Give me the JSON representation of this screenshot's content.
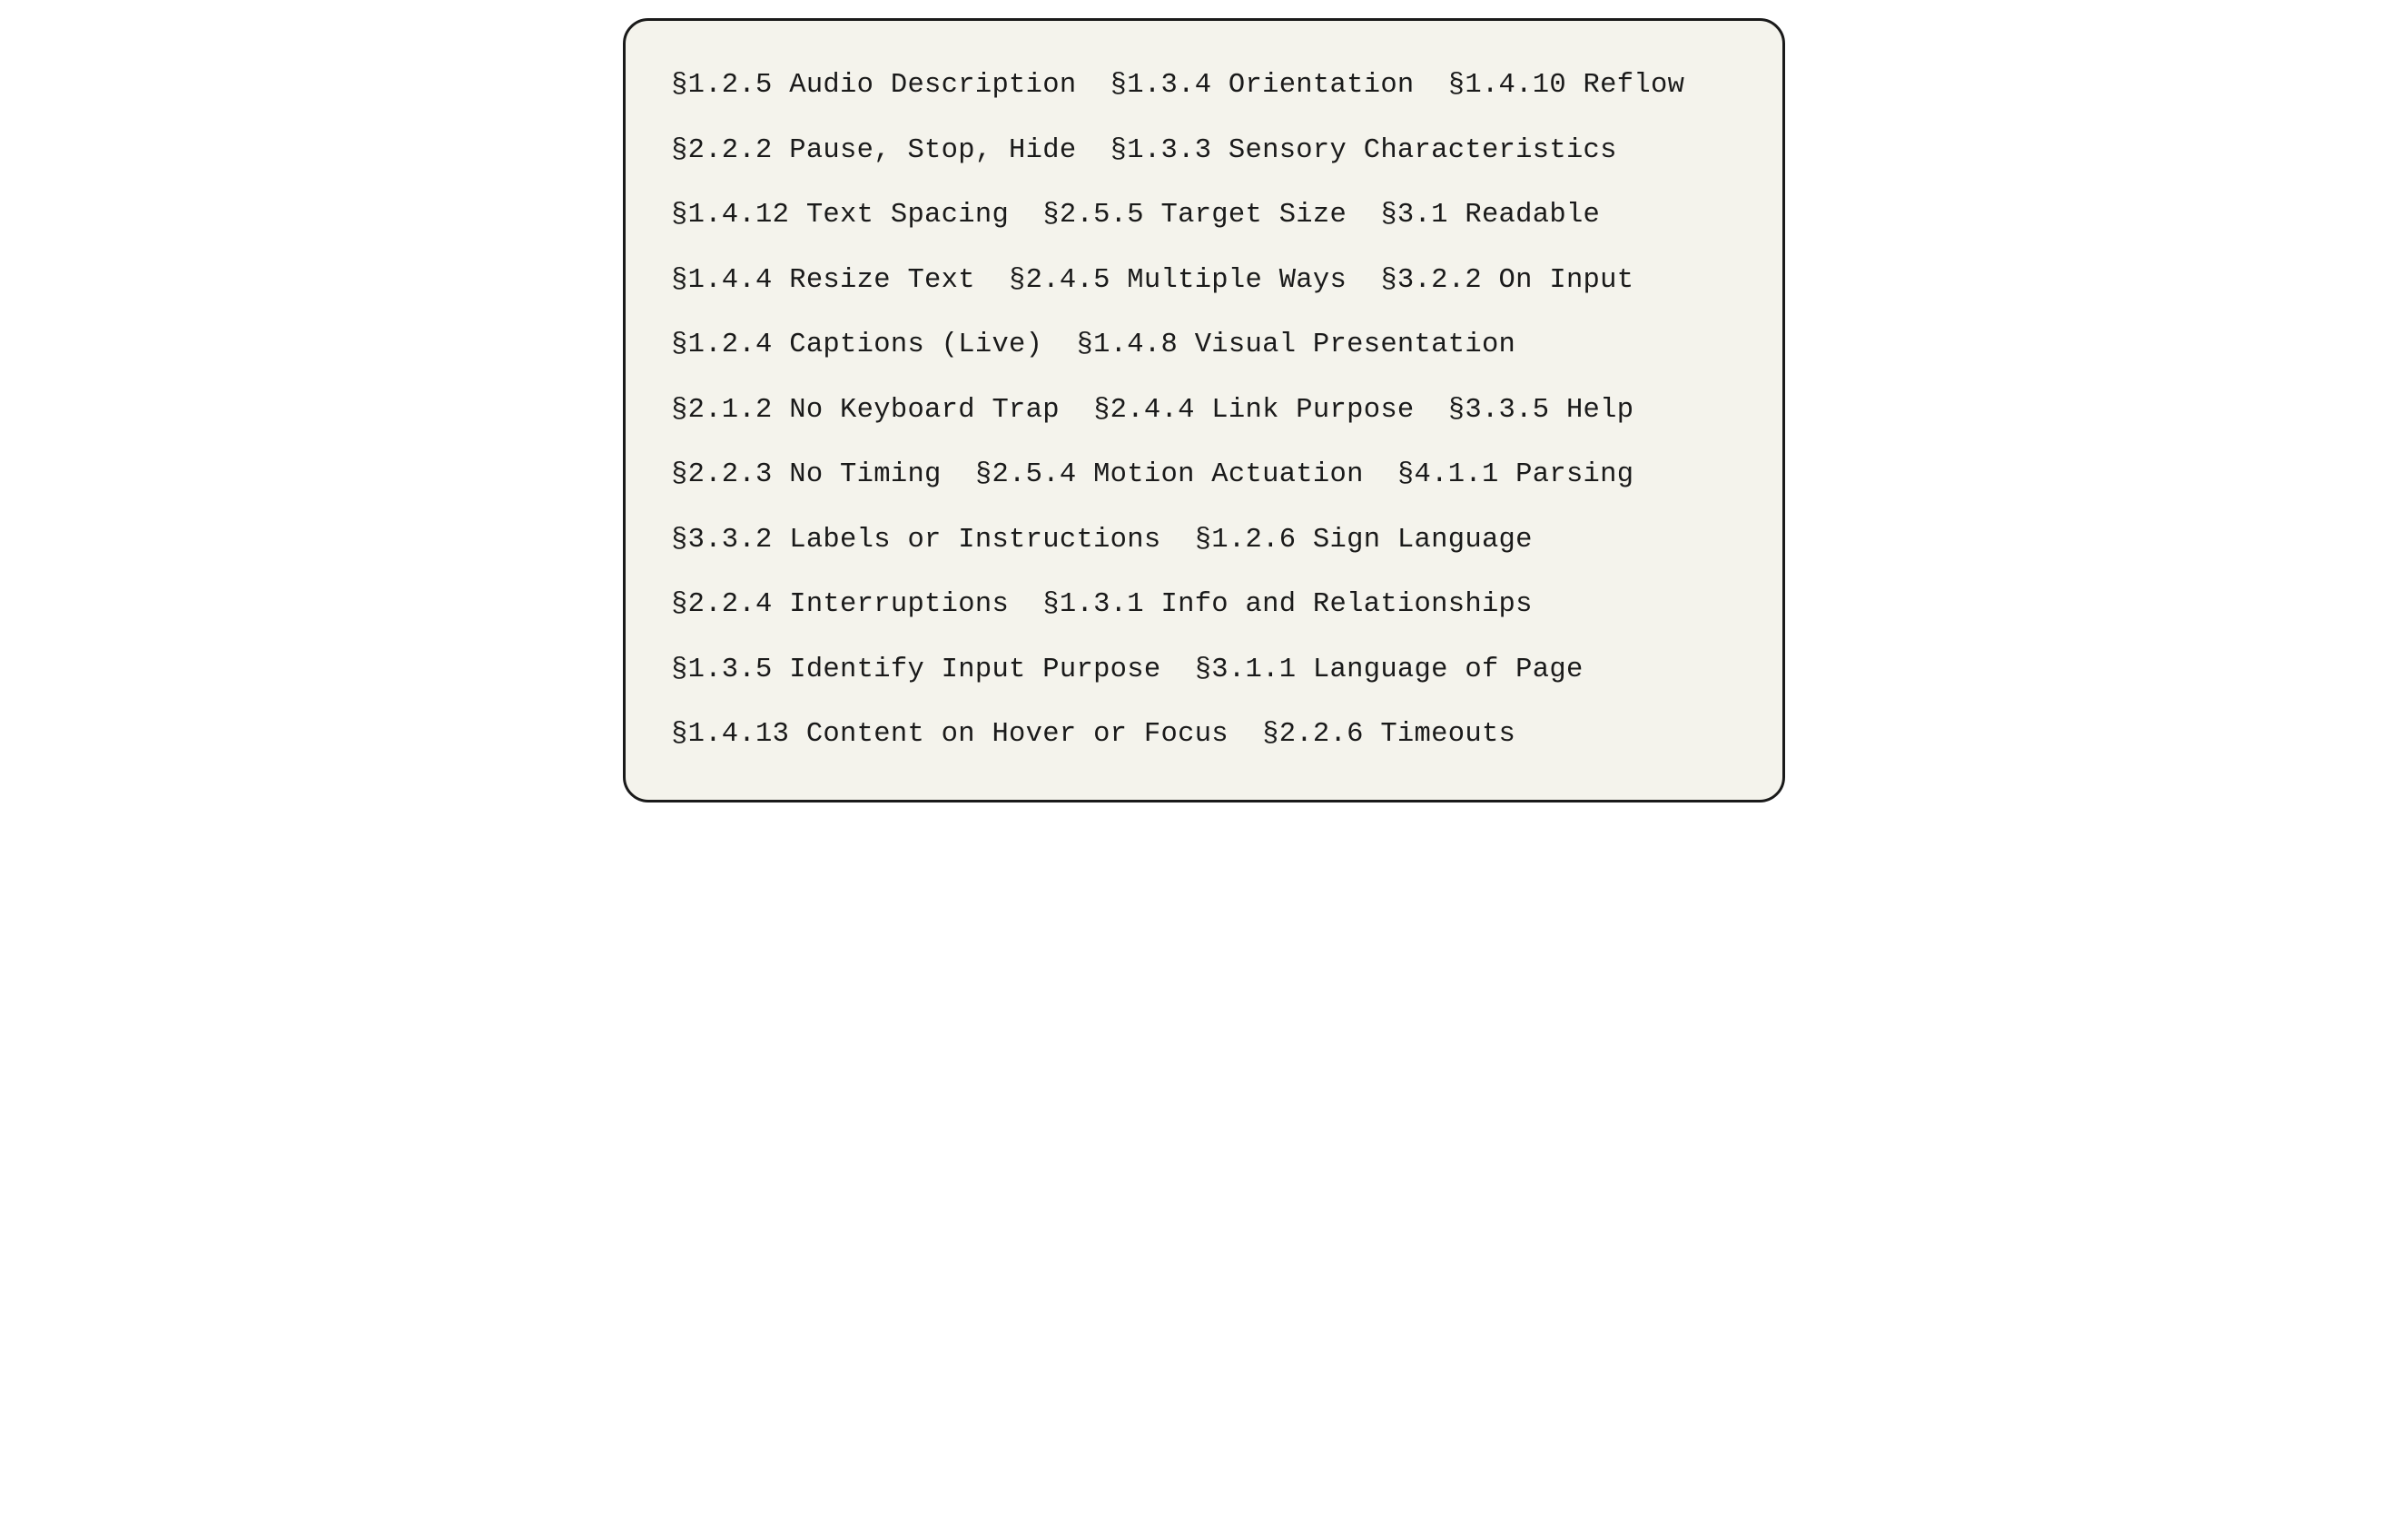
{
  "lines": [
    "§1.2.5 Audio Description  §1.3.4 Orientation  §1.4.10 Reflow",
    "§2.2.2 Pause, Stop, Hide  §1.3.3 Sensory Characteristics",
    "§1.4.12 Text Spacing  §2.5.5 Target Size  §3.1 Readable",
    "§1.4.4 Resize Text  §2.4.5 Multiple Ways  §3.2.2 On Input",
    "§1.2.4 Captions (Live)  §1.4.8 Visual Presentation",
    "§2.1.2 No Keyboard Trap  §2.4.4 Link Purpose  §3.3.5 Help",
    "§2.2.3 No Timing  §2.5.4 Motion Actuation  §4.1.1 Parsing",
    "§3.3.2 Labels or Instructions  §1.2.6 Sign Language",
    "§2.2.4 Interruptions  §1.3.1 Info and Relationships",
    "§1.3.5 Identify Input Purpose  §3.1.1 Language of Page",
    "§1.4.13 Content on Hover or Focus  §2.2.6 Timeouts"
  ],
  "entries": [
    {
      "section": "1.2.5",
      "title": "Audio Description"
    },
    {
      "section": "1.3.4",
      "title": "Orientation"
    },
    {
      "section": "1.4.10",
      "title": "Reflow"
    },
    {
      "section": "2.2.2",
      "title": "Pause, Stop, Hide"
    },
    {
      "section": "1.3.3",
      "title": "Sensory Characteristics"
    },
    {
      "section": "1.4.12",
      "title": "Text Spacing"
    },
    {
      "section": "2.5.5",
      "title": "Target Size"
    },
    {
      "section": "3.1",
      "title": "Readable"
    },
    {
      "section": "1.4.4",
      "title": "Resize Text"
    },
    {
      "section": "2.4.5",
      "title": "Multiple Ways"
    },
    {
      "section": "3.2.2",
      "title": "On Input"
    },
    {
      "section": "1.2.4",
      "title": "Captions (Live)"
    },
    {
      "section": "1.4.8",
      "title": "Visual Presentation"
    },
    {
      "section": "2.1.2",
      "title": "No Keyboard Trap"
    },
    {
      "section": "2.4.4",
      "title": "Link Purpose"
    },
    {
      "section": "3.3.5",
      "title": "Help"
    },
    {
      "section": "2.2.3",
      "title": "No Timing"
    },
    {
      "section": "2.5.4",
      "title": "Motion Actuation"
    },
    {
      "section": "4.1.1",
      "title": "Parsing"
    },
    {
      "section": "3.3.2",
      "title": "Labels or Instructions"
    },
    {
      "section": "1.2.6",
      "title": "Sign Language"
    },
    {
      "section": "2.2.4",
      "title": "Interruptions"
    },
    {
      "section": "1.3.1",
      "title": "Info and Relationships"
    },
    {
      "section": "1.3.5",
      "title": "Identify Input Purpose"
    },
    {
      "section": "3.1.1",
      "title": "Language of Page"
    },
    {
      "section": "1.4.13",
      "title": "Content on Hover or Focus"
    },
    {
      "section": "2.2.6",
      "title": "Timeouts"
    }
  ]
}
